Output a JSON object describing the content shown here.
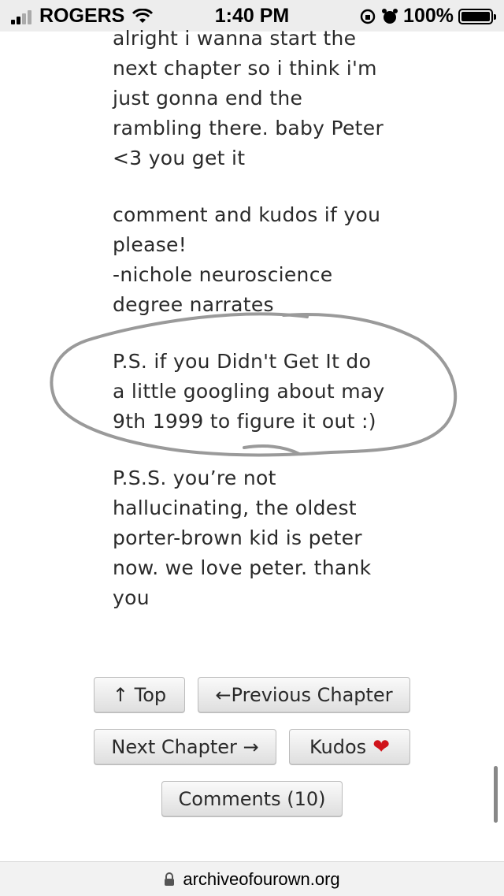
{
  "status_bar": {
    "carrier": "ROGERS",
    "time": "1:40 PM",
    "battery": "100%"
  },
  "content": {
    "paragraphs": [
      "alright i wanna start the next chapter so i think i'm just gonna end the rambling there. baby Peter <3 you get it",
      "comment and kudos if you please!",
      "-nichole neuroscience degree narrates",
      "P.S. if you Didn't Get It do a little googling about may 9th 1999 to figure it out :)",
      "P.S.S. you’re not hallucinating, the oldest porter-brown kid is peter now. we love peter. thank you"
    ],
    "lines": {
      "p1": [
        "alright i wanna start the",
        "next chapter so i think i'm",
        "just gonna end the",
        "rambling there. baby Peter",
        "<3 you get it"
      ],
      "p2": [
        "comment and kudos if you",
        "please!",
        "-nichole neuroscience",
        "degree narrates"
      ],
      "p3": [
        "P.S. if you Didn't Get It do",
        "a little googling about may",
        "9th 1999 to figure it out :)"
      ],
      "p4": [
        "P.S.S. you’re not",
        "hallucinating, the oldest",
        "porter-brown kid is peter",
        "now. we love peter. thank",
        "you"
      ]
    }
  },
  "nav": {
    "top_label": "↑ Top",
    "previous_label": "←Previous Chapter",
    "next_label": "Next Chapter →",
    "kudos_label": "Kudos",
    "comments_label": "Comments (10)"
  },
  "url_bar": {
    "domain": "archiveofourown.org"
  },
  "colors": {
    "heart": "#d0141b",
    "annotation_stroke": "#9a9a9a"
  }
}
